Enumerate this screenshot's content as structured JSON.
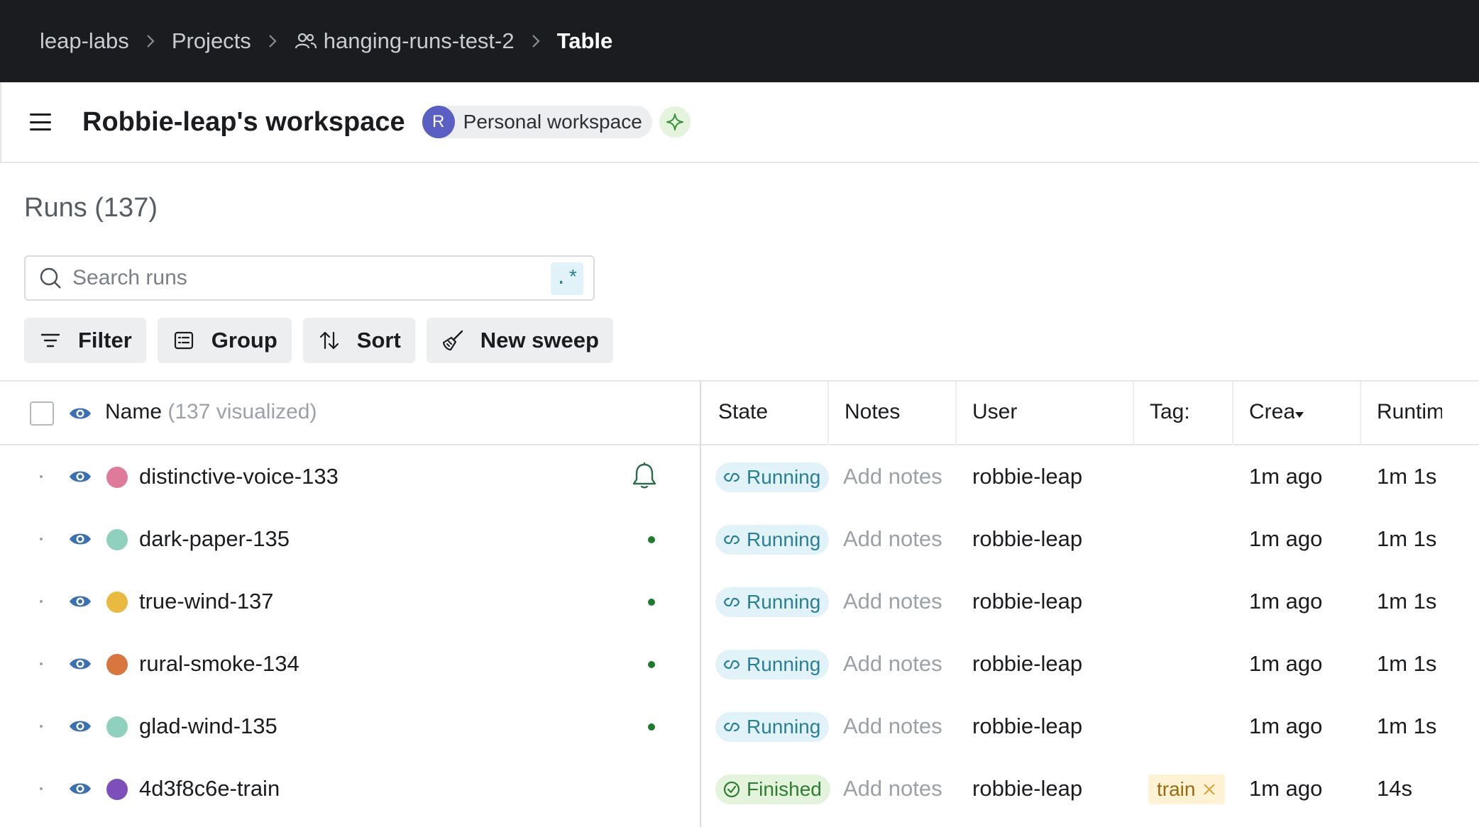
{
  "breadcrumb": {
    "items": [
      "leap-labs",
      "Projects",
      "hanging-runs-test-2",
      "Table"
    ]
  },
  "workspace": {
    "title": "Robbie-leap's workspace",
    "avatar_letter": "R",
    "chip_label": "Personal workspace"
  },
  "runs": {
    "title": "Runs (137)",
    "search_placeholder": "Search runs",
    "regex_label": ".*"
  },
  "toolbar": {
    "filter_label": "Filter",
    "group_label": "Group",
    "sort_label": "Sort",
    "sweep_label": "New sweep"
  },
  "table": {
    "columns": {
      "name": "Name",
      "name_suffix": "(137 visualized)",
      "state": "State",
      "notes": "Notes",
      "user": "User",
      "tags": "Tag:",
      "created": "Crea",
      "runtime": "Runtim"
    },
    "rows": [
      {
        "name": "distinctive-voice-133",
        "color": "#e07a9b",
        "state": "Running",
        "notes": "Add notes",
        "user": "robbie-leap",
        "tag": "",
        "created": "1m ago",
        "runtime": "1m 1s",
        "indicator": "bell"
      },
      {
        "name": "dark-paper-135",
        "color": "#8fd0bf",
        "state": "Running",
        "notes": "Add notes",
        "user": "robbie-leap",
        "tag": "",
        "created": "1m ago",
        "runtime": "1m 1s",
        "indicator": "dot"
      },
      {
        "name": "true-wind-137",
        "color": "#e9b940",
        "state": "Running",
        "notes": "Add notes",
        "user": "robbie-leap",
        "tag": "",
        "created": "1m ago",
        "runtime": "1m 1s",
        "indicator": "dot"
      },
      {
        "name": "rural-smoke-134",
        "color": "#d9753f",
        "state": "Running",
        "notes": "Add notes",
        "user": "robbie-leap",
        "tag": "",
        "created": "1m ago",
        "runtime": "1m 1s",
        "indicator": "dot"
      },
      {
        "name": "glad-wind-135",
        "color": "#8fd0bf",
        "state": "Running",
        "notes": "Add notes",
        "user": "robbie-leap",
        "tag": "",
        "created": "1m ago",
        "runtime": "1m 1s",
        "indicator": "dot"
      },
      {
        "name": "4d3f8c6e-train",
        "color": "#7e4fb8",
        "state": "Finished",
        "notes": "Add notes",
        "user": "robbie-leap",
        "tag": "train",
        "created": "1m ago",
        "runtime": "14s",
        "indicator": "none"
      }
    ]
  },
  "colors": {
    "topbar": "#1a1c1f",
    "running_bg": "#e1f3f8",
    "running_fg": "#2a7f95",
    "finished_bg": "#e3f3dc",
    "finished_fg": "#2f7d32",
    "eye": "#3d6fb3",
    "live_dot": "#1e7a2e"
  }
}
